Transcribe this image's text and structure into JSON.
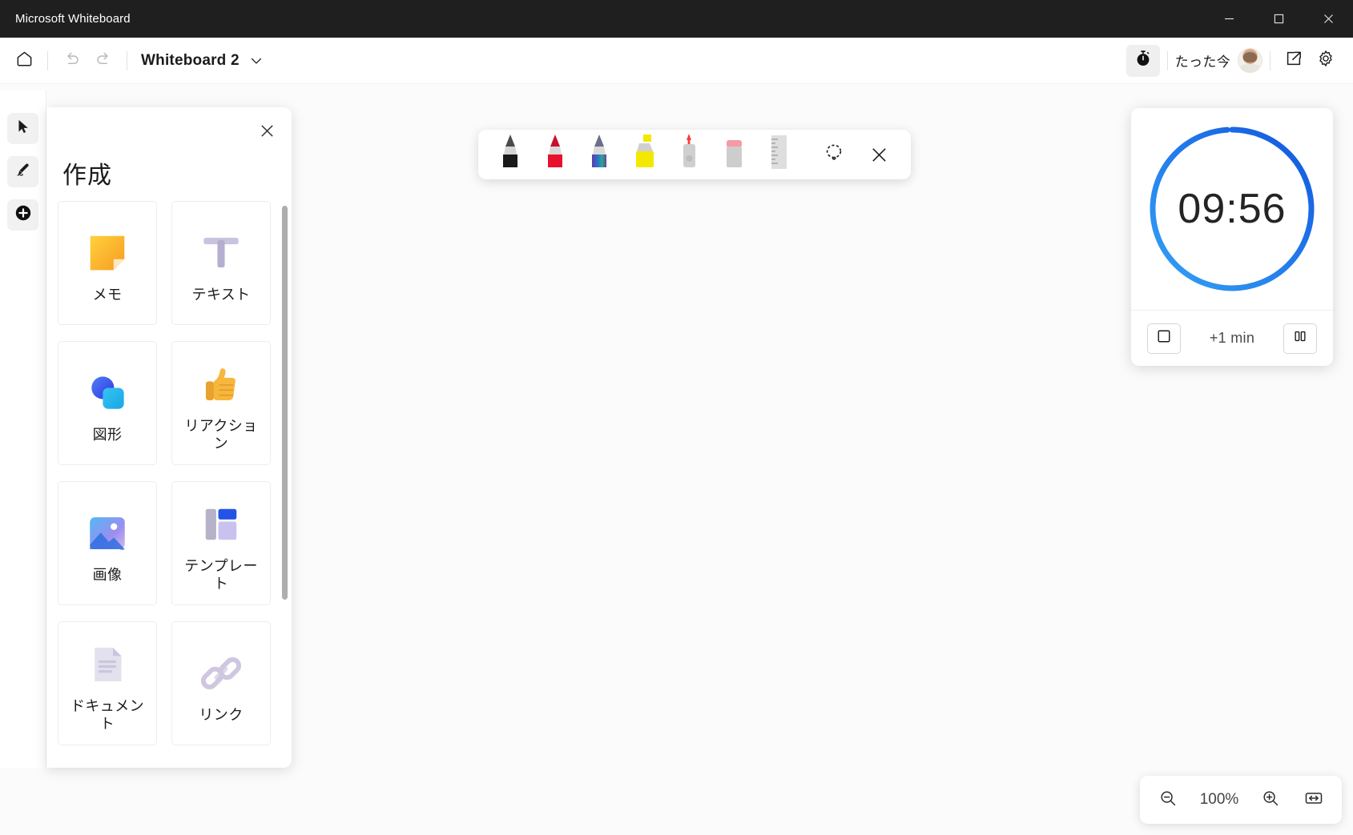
{
  "window": {
    "title": "Microsoft Whiteboard",
    "minimize_label": "—",
    "maximize_label": "□",
    "close_label": "✕"
  },
  "toolbar": {
    "home_icon": "home-icon",
    "undo_icon": "undo-icon",
    "redo_icon": "redo-icon",
    "board_title": "Whiteboard 2",
    "chevron_icon": "chevron-down-icon",
    "timer_icon": "stopwatch-icon",
    "presence_label": "たった今",
    "share_icon": "share-icon",
    "settings_icon": "gear-icon"
  },
  "rail": {
    "items": [
      {
        "name": "select-tool",
        "icon": "cursor-icon"
      },
      {
        "name": "ink-tool",
        "icon": "pen-icon"
      },
      {
        "name": "create-tool",
        "icon": "plus-circle-icon"
      }
    ]
  },
  "create_panel": {
    "title": "作成",
    "close_label": "✕",
    "items": [
      {
        "label": "メモ",
        "icon": "sticky-note-icon"
      },
      {
        "label": "テキスト",
        "icon": "text-icon"
      },
      {
        "label": "図形",
        "icon": "shapes-icon"
      },
      {
        "label": "リアクション",
        "icon": "thumbs-up-icon"
      },
      {
        "label": "画像",
        "icon": "image-icon"
      },
      {
        "label": "テンプレート",
        "icon": "template-icon"
      },
      {
        "label": "ドキュメント",
        "icon": "document-icon"
      },
      {
        "label": "リンク",
        "icon": "link-icon"
      }
    ]
  },
  "pen_toolbar": {
    "tools": [
      {
        "name": "pen-black",
        "icon": "pen-icon",
        "color": "#1a1a1a"
      },
      {
        "name": "pen-red",
        "icon": "pen-icon",
        "color": "#e8112d"
      },
      {
        "name": "pen-rainbow",
        "icon": "pen-icon",
        "color": "#5a3fa0"
      },
      {
        "name": "highlighter-yellow",
        "icon": "highlighter-icon",
        "color": "#f2e800"
      },
      {
        "name": "laser-pointer",
        "icon": "laser-pointer-icon",
        "color": "#fb4b4b"
      },
      {
        "name": "eraser",
        "icon": "eraser-icon",
        "color": "#f09aa5"
      },
      {
        "name": "ruler",
        "icon": "ruler-icon",
        "color": "#d3d3d3"
      }
    ],
    "lasso_icon": "lasso-select-icon",
    "close_label": "✕"
  },
  "timer": {
    "value": "09:56",
    "progress_percent": 99,
    "ring_color": "#1f86f0",
    "stop_icon": "stop-square-icon",
    "add_label": "+1 min",
    "pause_icon": "pause-icon"
  },
  "zoom_bar": {
    "zoom_out_icon": "magnifier-minus-icon",
    "level": "100%",
    "zoom_in_icon": "magnifier-plus-icon",
    "fit_icon": "fit-to-screen-icon"
  }
}
